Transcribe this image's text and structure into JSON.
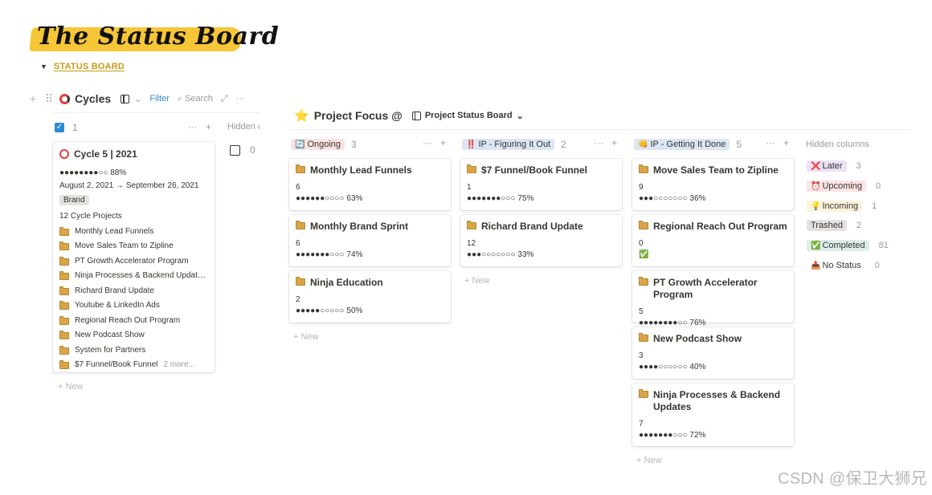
{
  "page": {
    "banner_title": "The Status Board",
    "section_toggle": "STATUS BOARD",
    "watermark": "CSDN @保卫大狮兄"
  },
  "cycles": {
    "title": "Cycles",
    "filter_label": "Filter",
    "search_label": "Search",
    "group_checked_count": "1",
    "group_unchecked_count": "0",
    "hidden_label": "Hidden c",
    "new_label": "New",
    "card": {
      "title": "Cycle 5 | 2021",
      "progress_dots": "●●●●●●●●○○",
      "progress_pct": "88%",
      "progress_value": 0.88,
      "date_range": "August 2, 2021 → September 26, 2021",
      "tag": "Brand",
      "projects_label": "12 Cycle Projects",
      "projects": [
        "Monthly Lead Funnels",
        "Move Sales Team to Zipline",
        "PT Growth Accelerator Program",
        "Ninja Processes & Backend Updat…",
        "Richard Brand Update",
        "Youtube & LinkedIn Ads",
        "Regional Reach Out Program",
        "New Podcast Show",
        "System for Partners",
        "$7 Funnel/Book Funnel"
      ],
      "more_label": "2 more..."
    }
  },
  "focus": {
    "title": "Project Focus @",
    "view_label": "Project Status Board",
    "new_label": "New",
    "hidden_columns_label": "Hidden columns",
    "columns": [
      {
        "label": "Ongoing",
        "emoji": "🔄",
        "count": "3",
        "color": "#fbe4e0",
        "cards": [
          {
            "title": "Monthly Lead Funnels",
            "num": "6",
            "dots": "●●●●●●○○○○",
            "pct": "63%",
            "value": 0.63
          },
          {
            "title": "Monthly Brand Sprint",
            "num": "6",
            "dots": "●●●●●●●○○○",
            "pct": "74%",
            "value": 0.74
          },
          {
            "title": "Ninja Education",
            "num": "2",
            "dots": "●●●●●○○○○○",
            "pct": "50%",
            "value": 0.5
          }
        ]
      },
      {
        "label": "IP - Figuring It Out",
        "emoji": "‼️",
        "count": "2",
        "color": "#dbe6f5",
        "cards": [
          {
            "title": "$7 Funnel/Book Funnel",
            "num": "1",
            "dots": "●●●●●●●○○○",
            "pct": "75%",
            "value": 0.75
          },
          {
            "title": "Richard Brand Update",
            "num": "12",
            "dots": "●●●○○○○○○○",
            "pct": "33%",
            "value": 0.33
          }
        ]
      },
      {
        "label": "IP - Getting It Done",
        "emoji": "👊",
        "count": "5",
        "color": "#dbe6f5",
        "cards": [
          {
            "title": "Move Sales Team to Zipline",
            "num": "9",
            "dots": "●●●○○○○○○○",
            "pct": "36%",
            "value": 0.36
          },
          {
            "title": "Regional Reach Out Program",
            "num": "0",
            "check": "✅"
          },
          {
            "title": "PT Growth Accelerator Program",
            "num": "5",
            "dots": "●●●●●●●●○○",
            "pct": "76%",
            "value": 0.76
          },
          {
            "title": "New Podcast Show",
            "num": "3",
            "dots": "●●●●○○○○○○",
            "pct": "40%",
            "value": 0.4
          },
          {
            "title": "Ninja Processes & Backend Updates",
            "num": "7",
            "dots": "●●●●●●●○○○",
            "pct": "72%",
            "value": 0.72
          }
        ]
      }
    ],
    "hidden_columns": [
      {
        "emoji": "❌",
        "label": "Later",
        "count": "3",
        "color": "#eae1f6"
      },
      {
        "emoji": "⏰",
        "label": "Upcoming",
        "count": "0",
        "color": "#fbe4e4"
      },
      {
        "emoji": "💡",
        "label": "Incoming",
        "count": "1",
        "color": "#fbf3db"
      },
      {
        "emoji": "",
        "label": "Trashed",
        "count": "2",
        "color": "#e3e2e0"
      },
      {
        "emoji": "✅",
        "label": "Completed",
        "count": "81",
        "color": "#ddedea"
      },
      {
        "emoji": "📥",
        "label": "No Status",
        "count": "0",
        "color": ""
      }
    ]
  }
}
